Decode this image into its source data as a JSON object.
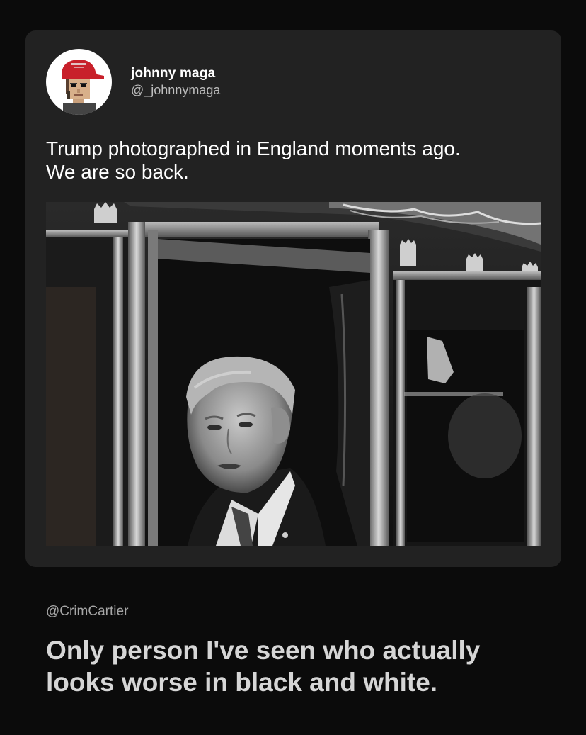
{
  "post": {
    "author": {
      "display_name": "johnny maga",
      "handle": "@_johnnymaga",
      "avatar_icon": "pixel-avatar-red-cap"
    },
    "text": "Trump photographed in England moments ago.\nWe are so back.",
    "photo": {
      "style": "black-and-white"
    }
  },
  "caption": {
    "handle": "@CrimCartier",
    "text": "Only person I've seen who actually\nlooks worse in black and white."
  },
  "colors": {
    "page_background": "#0b0b0b",
    "card_background": "#222222",
    "cap_red": "#c8202a"
  }
}
